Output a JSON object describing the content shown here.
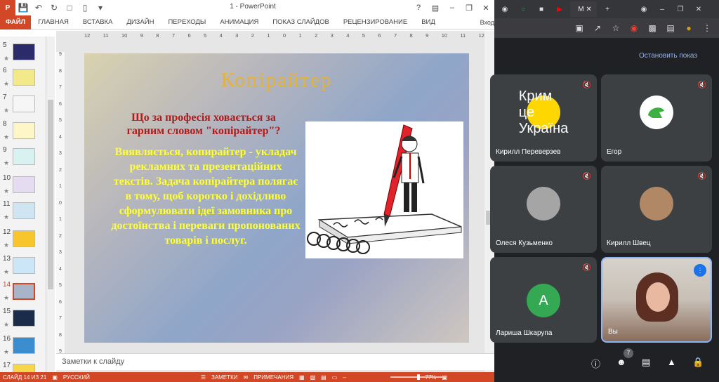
{
  "ppt": {
    "title": "1 - PowerPoint",
    "tabs": [
      "ФАЙЛ",
      "ГЛАВНАЯ",
      "ВСТАВКА",
      "ДИЗАЙН",
      "ПЕРЕХОДЫ",
      "АНИМАЦИЯ",
      "ПОКАЗ СЛАЙДОВ",
      "РЕЦЕНЗИРОВАНИЕ",
      "ВИД"
    ],
    "login": "Вход",
    "slides": [
      "5",
      "6",
      "7",
      "8",
      "9",
      "10",
      "11",
      "12",
      "13",
      "14",
      "15",
      "16",
      "17"
    ],
    "selected_slide": "14",
    "hruler": [
      "12",
      "11",
      "10",
      "9",
      "8",
      "7",
      "6",
      "5",
      "4",
      "3",
      "2",
      "1",
      "0",
      "1",
      "2",
      "3",
      "4",
      "5",
      "6",
      "7",
      "8",
      "9",
      "10",
      "11",
      "12"
    ],
    "vruler": [
      "9",
      "8",
      "7",
      "6",
      "5",
      "4",
      "3",
      "2",
      "1",
      "0",
      "1",
      "2",
      "3",
      "4",
      "5",
      "6",
      "7",
      "8",
      "9"
    ],
    "slide": {
      "title": "Копірайтер",
      "question": "Що за професія ховається за гарним словом \"копірайтер\"?",
      "body": "Виявляється, копирайтер - укладач рекламних та презентаційних текстів. Задача копірайтера полягає в тому, щоб коротко і дохідливо сформулювати ідеї замовника про достоїнства і переваги пропонованих товарів і послуг."
    },
    "notes": "Заметки к слайду",
    "status": {
      "slide": "СЛАЙД 14 ИЗ 21",
      "lang": "РУССКИЙ",
      "notes": "ЗАМЕТКИ",
      "comments": "ПРИМЕЧАНИЯ",
      "zoom": "77%"
    }
  },
  "meet": {
    "stop_share": "Остановить показ",
    "participants": [
      {
        "name": "Кирилл Переверзев",
        "avatar": "Крим це Україна"
      },
      {
        "name": "Егор",
        "avatar": ""
      },
      {
        "name": "Олеся Кузьменко",
        "avatar": ""
      },
      {
        "name": "Кирилл Швец",
        "avatar": ""
      },
      {
        "name": "Лариша Шкарупа",
        "avatar": "A"
      },
      {
        "name": "Вы",
        "avatar": ""
      }
    ],
    "participant_count": "7",
    "colors": {
      "accent": "#8ab4f8",
      "ppt": "#d24726"
    }
  }
}
